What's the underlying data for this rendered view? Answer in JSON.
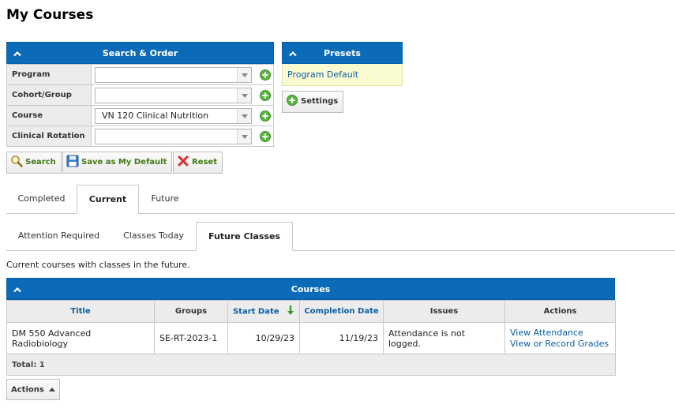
{
  "page_title": "My Courses",
  "search_order": {
    "title": "Search & Order",
    "fields": [
      {
        "label": "Program",
        "value": ""
      },
      {
        "label": "Cohort/Group",
        "value": ""
      },
      {
        "label": "Course",
        "value": "VN 120 Clinical Nutrition"
      },
      {
        "label": "Clinical Rotation",
        "value": ""
      }
    ],
    "buttons": {
      "search": "Search",
      "save_default": "Save as My Default",
      "reset": "Reset"
    }
  },
  "presets": {
    "title": "Presets",
    "item": "Program Default",
    "settings_button": "Settings"
  },
  "tabs_primary": {
    "items": [
      "Completed",
      "Current",
      "Future"
    ],
    "active": "Current"
  },
  "tabs_secondary": {
    "items": [
      "Attention Required",
      "Classes Today",
      "Future Classes"
    ],
    "active": "Future Classes"
  },
  "description": "Current courses with classes in the future.",
  "courses": {
    "title": "Courses",
    "columns": [
      "Title",
      "Groups",
      "Start Date",
      "Completion Date",
      "Issues",
      "Actions"
    ],
    "rows": [
      {
        "title": "DM 550 Advanced Radiobiology",
        "groups": "SE-RT-2023-1",
        "start_date": "10/29/23",
        "completion_date": "11/19/23",
        "issues": "Attendance is not logged.",
        "actions": [
          "View Attendance",
          "View or Record Grades"
        ]
      }
    ],
    "total_label": "Total: 1"
  },
  "actions_button": "Actions",
  "colors": {
    "header_blue": "#0b6bb8",
    "link_blue": "#0b5ea8",
    "preset_yellow": "#fbfbd0",
    "sort_arrow_green": "#3a9a2a"
  }
}
